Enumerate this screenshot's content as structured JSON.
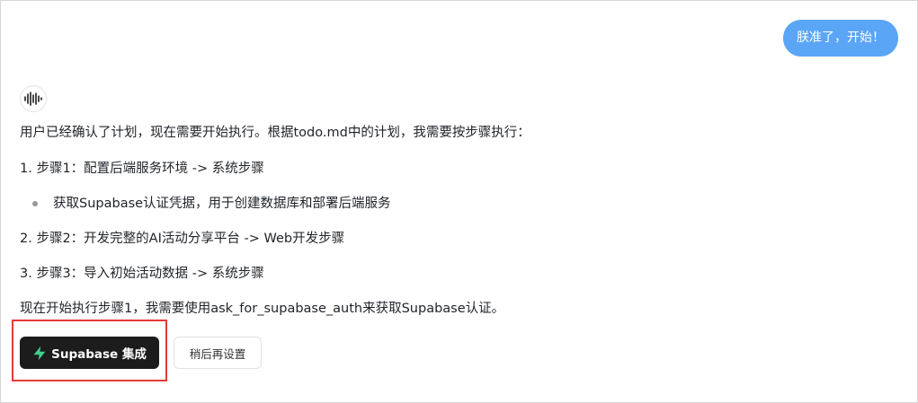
{
  "user_message": "朕准了，开始！",
  "assistant": {
    "avatar_icon": "waveform-logo-icon",
    "intro": "用户已经确认了计划，现在需要开始执行。根据todo.md中的计划，我需要按步骤执行：",
    "step1": "1. 步骤1：配置后端服务环境 -> 系统步骤",
    "step1_bullet": "获取Supabase认证凭据，用于创建数据库和部署后端服务",
    "step2": "2. 步骤2：开发完整的AI活动分享平台 -> Web开发步骤",
    "step3": "3. 步骤3：导入初始活动数据 -> 系统步骤",
    "conclusion": "现在开始执行步骤1，我需要使用ask_for_supabase_auth来获取Supabase认证。"
  },
  "actions": {
    "primary_label": "Supabase 集成",
    "primary_icon": "supabase-bolt-icon",
    "secondary_label": "稍后再设置"
  },
  "colors": {
    "user_bubble": "#5aa5f6",
    "primary_button": "#1c1c1c",
    "supabase_green": "#3ecf8e",
    "highlight_border": "#e53935"
  }
}
